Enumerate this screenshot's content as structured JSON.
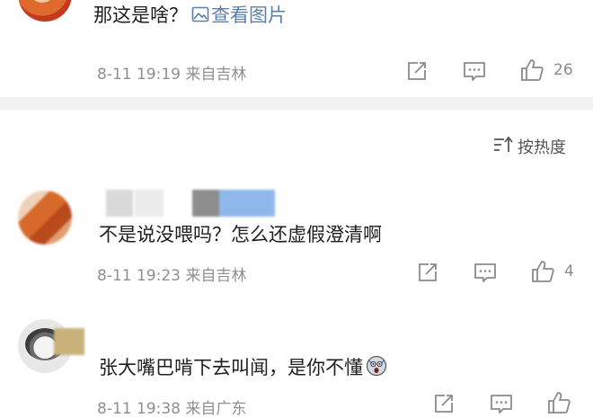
{
  "comments_top": {
    "text": "那这是啥？",
    "image_link_label": "查看图片",
    "meta": "8-11 19:19 来自吉林",
    "likes": "26"
  },
  "sort": {
    "label": "按热度"
  },
  "comments": [
    {
      "text": "不是说没喂吗？怎么还虚假澄清啊",
      "meta": "8-11 19:23 来自吉林",
      "likes": "4"
    },
    {
      "text": "张大嘴巴啃下去叫闻，是你不懂",
      "meta": "8-11 19:38 来自广东"
    }
  ],
  "colors": {
    "link": "#5b7fa8",
    "meta_gray": "#8f8f8f",
    "divider": "#f2f2f2"
  },
  "icons": [
    "image-icon",
    "share-icon",
    "comment-icon",
    "like-icon",
    "sort-icon",
    "scared-emoji-icon"
  ]
}
